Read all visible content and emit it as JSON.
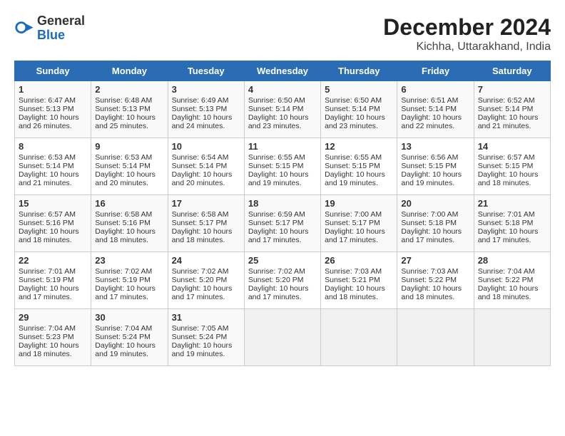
{
  "logo": {
    "general": "General",
    "blue": "Blue"
  },
  "title": "December 2024",
  "location": "Kichha, Uttarakhand, India",
  "days_of_week": [
    "Sunday",
    "Monday",
    "Tuesday",
    "Wednesday",
    "Thursday",
    "Friday",
    "Saturday"
  ],
  "weeks": [
    [
      {
        "day": "1",
        "lines": [
          "Sunrise: 6:47 AM",
          "Sunset: 5:13 PM",
          "Daylight: 10 hours",
          "and 26 minutes."
        ]
      },
      {
        "day": "2",
        "lines": [
          "Sunrise: 6:48 AM",
          "Sunset: 5:13 PM",
          "Daylight: 10 hours",
          "and 25 minutes."
        ]
      },
      {
        "day": "3",
        "lines": [
          "Sunrise: 6:49 AM",
          "Sunset: 5:13 PM",
          "Daylight: 10 hours",
          "and 24 minutes."
        ]
      },
      {
        "day": "4",
        "lines": [
          "Sunrise: 6:50 AM",
          "Sunset: 5:14 PM",
          "Daylight: 10 hours",
          "and 23 minutes."
        ]
      },
      {
        "day": "5",
        "lines": [
          "Sunrise: 6:50 AM",
          "Sunset: 5:14 PM",
          "Daylight: 10 hours",
          "and 23 minutes."
        ]
      },
      {
        "day": "6",
        "lines": [
          "Sunrise: 6:51 AM",
          "Sunset: 5:14 PM",
          "Daylight: 10 hours",
          "and 22 minutes."
        ]
      },
      {
        "day": "7",
        "lines": [
          "Sunrise: 6:52 AM",
          "Sunset: 5:14 PM",
          "Daylight: 10 hours",
          "and 21 minutes."
        ]
      }
    ],
    [
      {
        "day": "8",
        "lines": [
          "Sunrise: 6:53 AM",
          "Sunset: 5:14 PM",
          "Daylight: 10 hours",
          "and 21 minutes."
        ]
      },
      {
        "day": "9",
        "lines": [
          "Sunrise: 6:53 AM",
          "Sunset: 5:14 PM",
          "Daylight: 10 hours",
          "and 20 minutes."
        ]
      },
      {
        "day": "10",
        "lines": [
          "Sunrise: 6:54 AM",
          "Sunset: 5:14 PM",
          "Daylight: 10 hours",
          "and 20 minutes."
        ]
      },
      {
        "day": "11",
        "lines": [
          "Sunrise: 6:55 AM",
          "Sunset: 5:15 PM",
          "Daylight: 10 hours",
          "and 19 minutes."
        ]
      },
      {
        "day": "12",
        "lines": [
          "Sunrise: 6:55 AM",
          "Sunset: 5:15 PM",
          "Daylight: 10 hours",
          "and 19 minutes."
        ]
      },
      {
        "day": "13",
        "lines": [
          "Sunrise: 6:56 AM",
          "Sunset: 5:15 PM",
          "Daylight: 10 hours",
          "and 19 minutes."
        ]
      },
      {
        "day": "14",
        "lines": [
          "Sunrise: 6:57 AM",
          "Sunset: 5:15 PM",
          "Daylight: 10 hours",
          "and 18 minutes."
        ]
      }
    ],
    [
      {
        "day": "15",
        "lines": [
          "Sunrise: 6:57 AM",
          "Sunset: 5:16 PM",
          "Daylight: 10 hours",
          "and 18 minutes."
        ]
      },
      {
        "day": "16",
        "lines": [
          "Sunrise: 6:58 AM",
          "Sunset: 5:16 PM",
          "Daylight: 10 hours",
          "and 18 minutes."
        ]
      },
      {
        "day": "17",
        "lines": [
          "Sunrise: 6:58 AM",
          "Sunset: 5:17 PM",
          "Daylight: 10 hours",
          "and 18 minutes."
        ]
      },
      {
        "day": "18",
        "lines": [
          "Sunrise: 6:59 AM",
          "Sunset: 5:17 PM",
          "Daylight: 10 hours",
          "and 17 minutes."
        ]
      },
      {
        "day": "19",
        "lines": [
          "Sunrise: 7:00 AM",
          "Sunset: 5:17 PM",
          "Daylight: 10 hours",
          "and 17 minutes."
        ]
      },
      {
        "day": "20",
        "lines": [
          "Sunrise: 7:00 AM",
          "Sunset: 5:18 PM",
          "Daylight: 10 hours",
          "and 17 minutes."
        ]
      },
      {
        "day": "21",
        "lines": [
          "Sunrise: 7:01 AM",
          "Sunset: 5:18 PM",
          "Daylight: 10 hours",
          "and 17 minutes."
        ]
      }
    ],
    [
      {
        "day": "22",
        "lines": [
          "Sunrise: 7:01 AM",
          "Sunset: 5:19 PM",
          "Daylight: 10 hours",
          "and 17 minutes."
        ]
      },
      {
        "day": "23",
        "lines": [
          "Sunrise: 7:02 AM",
          "Sunset: 5:19 PM",
          "Daylight: 10 hours",
          "and 17 minutes."
        ]
      },
      {
        "day": "24",
        "lines": [
          "Sunrise: 7:02 AM",
          "Sunset: 5:20 PM",
          "Daylight: 10 hours",
          "and 17 minutes."
        ]
      },
      {
        "day": "25",
        "lines": [
          "Sunrise: 7:02 AM",
          "Sunset: 5:20 PM",
          "Daylight: 10 hours",
          "and 17 minutes."
        ]
      },
      {
        "day": "26",
        "lines": [
          "Sunrise: 7:03 AM",
          "Sunset: 5:21 PM",
          "Daylight: 10 hours",
          "and 18 minutes."
        ]
      },
      {
        "day": "27",
        "lines": [
          "Sunrise: 7:03 AM",
          "Sunset: 5:22 PM",
          "Daylight: 10 hours",
          "and 18 minutes."
        ]
      },
      {
        "day": "28",
        "lines": [
          "Sunrise: 7:04 AM",
          "Sunset: 5:22 PM",
          "Daylight: 10 hours",
          "and 18 minutes."
        ]
      }
    ],
    [
      {
        "day": "29",
        "lines": [
          "Sunrise: 7:04 AM",
          "Sunset: 5:23 PM",
          "Daylight: 10 hours",
          "and 18 minutes."
        ]
      },
      {
        "day": "30",
        "lines": [
          "Sunrise: 7:04 AM",
          "Sunset: 5:24 PM",
          "Daylight: 10 hours",
          "and 19 minutes."
        ]
      },
      {
        "day": "31",
        "lines": [
          "Sunrise: 7:05 AM",
          "Sunset: 5:24 PM",
          "Daylight: 10 hours",
          "and 19 minutes."
        ]
      },
      {
        "day": "",
        "lines": []
      },
      {
        "day": "",
        "lines": []
      },
      {
        "day": "",
        "lines": []
      },
      {
        "day": "",
        "lines": []
      }
    ]
  ]
}
